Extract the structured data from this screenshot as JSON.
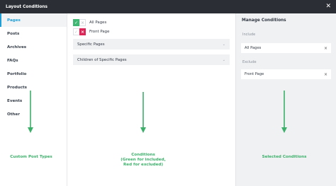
{
  "header": {
    "title": "Layout Conditions",
    "close_icon": "close-icon"
  },
  "sidebar": {
    "items": [
      {
        "label": "Pages",
        "active": true
      },
      {
        "label": "Posts",
        "active": false
      },
      {
        "label": "Archives",
        "active": false
      },
      {
        "label": "FAQs",
        "active": false
      },
      {
        "label": "Portfolio",
        "active": false
      },
      {
        "label": "Products",
        "active": false
      },
      {
        "label": "Events",
        "active": false
      },
      {
        "label": "Other",
        "active": false
      }
    ]
  },
  "conditions": {
    "items": [
      {
        "label": "All Pages",
        "state": "included"
      },
      {
        "label": "Front Page",
        "state": "excluded"
      }
    ],
    "expanders": [
      {
        "label": "Specific Pages"
      },
      {
        "label": "Children of Specific Pages"
      }
    ]
  },
  "manage": {
    "title": "Manage Conditions",
    "include_label": "Include",
    "include_items": [
      "All Pages"
    ],
    "exclude_label": "Exclude",
    "exclude_items": [
      "Front Page"
    ]
  },
  "annotations": {
    "left": "Custom Post Types",
    "middle_line1": "Conditions",
    "middle_line2": "(Green for included,",
    "middle_line3": "Red for excluded)",
    "right": "Selected Conditions"
  },
  "colors": {
    "header_bg": "#2b2f35",
    "accent_blue": "#1f9fd8",
    "include_green": "#3fb873",
    "exclude_red": "#dd2557",
    "annotation_green": "#3cb06a"
  }
}
